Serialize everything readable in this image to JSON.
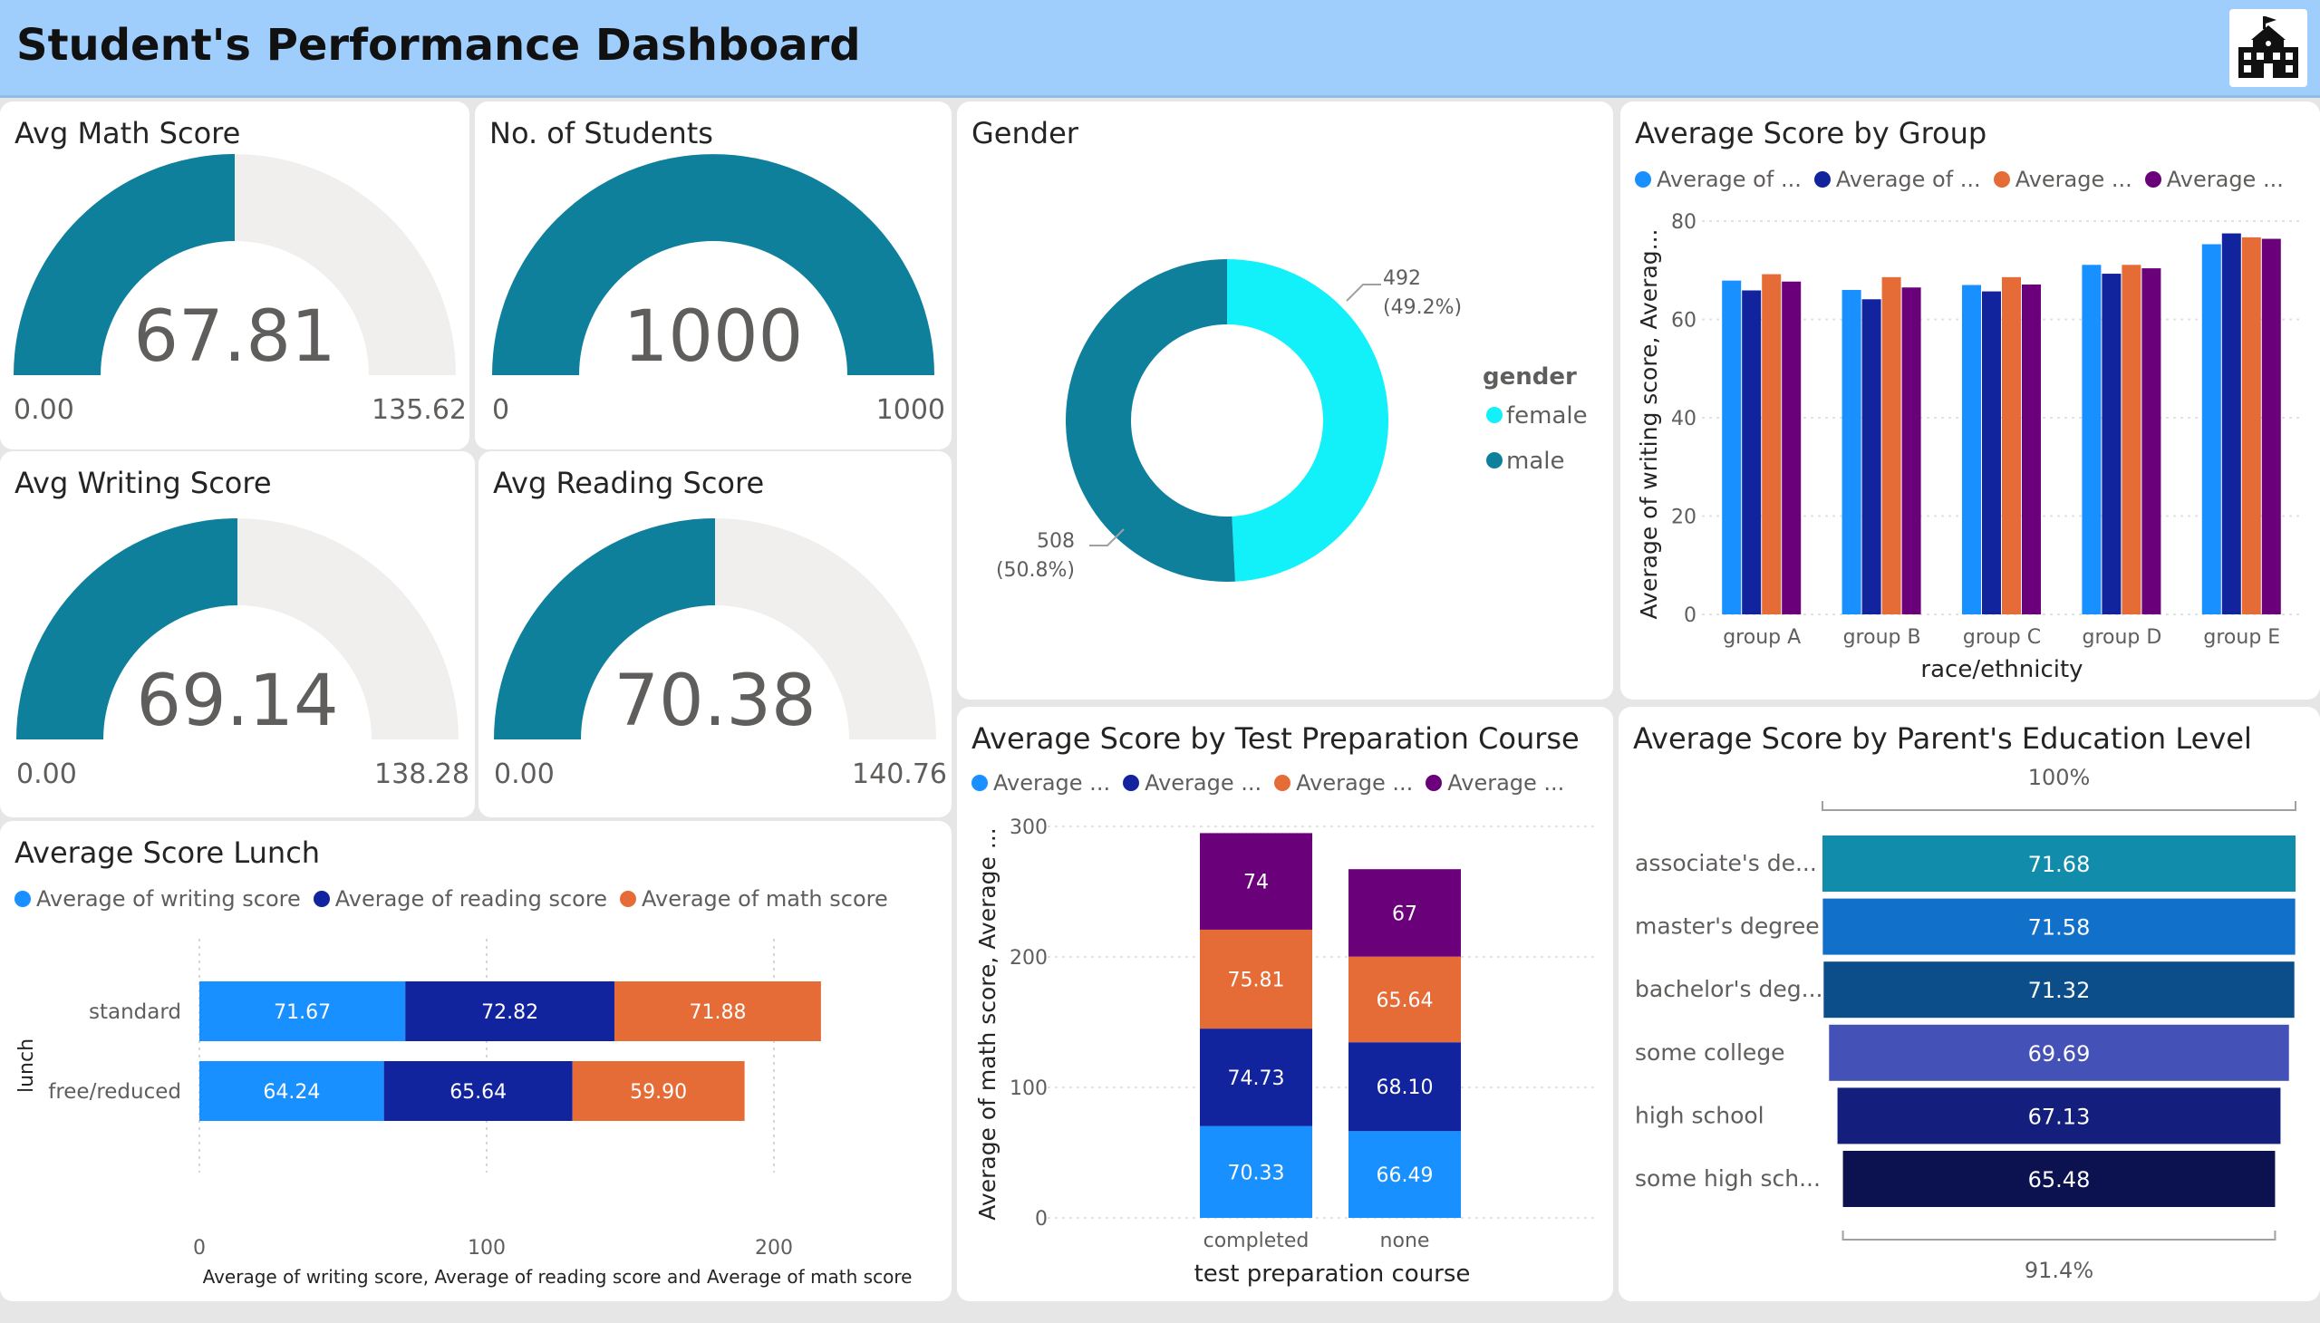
{
  "header": {
    "title": "Student's Performance Dashboard",
    "logo_icon": "school-building-icon"
  },
  "colors": {
    "teal": "#0e809c",
    "gauge_bg": "#f0efee",
    "c1": "#1890ff",
    "c2": "#12239e",
    "c3": "#e66c37",
    "c4": "#6b007b",
    "cyan": "#12f1fa"
  },
  "gauges": [
    {
      "title": "Avg Math Score",
      "value": 67.81,
      "value_label": "67.81",
      "min_label": "0.00",
      "max_label": "135.62",
      "fill_fraction": 0.5
    },
    {
      "title": "No. of Students",
      "value": 1000,
      "value_label": "1000",
      "min_label": "0",
      "max_label": "1000",
      "fill_fraction": 1.0
    },
    {
      "title": "Avg Writing Score",
      "value": 69.14,
      "value_label": "69.14",
      "min_label": "0.00",
      "max_label": "138.28",
      "fill_fraction": 0.5
    },
    {
      "title": "Avg Reading Score",
      "value": 70.38,
      "value_label": "70.38",
      "min_label": "0.00",
      "max_label": "140.76",
      "fill_fraction": 0.5
    }
  ],
  "gender": {
    "title": "Gender",
    "legend_title": "gender",
    "slices": [
      {
        "label": "female",
        "value": 492,
        "value_label": "492",
        "pct_label": "(49.2%)"
      },
      {
        "label": "male",
        "value": 508,
        "value_label": "508",
        "pct_label": "(50.8%)"
      }
    ]
  },
  "group": {
    "title": "Average Score by Group",
    "legend": [
      "Average of ...",
      "Average of ...",
      "Average ...",
      "Average ..."
    ],
    "ylabel": "Average of writing score, Averag...",
    "xlabel": "race/ethnicity",
    "yticks": [
      "0",
      "20",
      "40",
      "60",
      "80"
    ]
  },
  "lunch": {
    "title": "Average Score Lunch",
    "legend": [
      "Average of writing score",
      "Average of reading score",
      "Average of math score"
    ],
    "ylabel": "lunch",
    "xlabel": "Average of writing score, Average of reading score and Average of math score",
    "xticks": [
      "0",
      "100",
      "200"
    ]
  },
  "prep": {
    "title": "Average Score by Test Preparation Course",
    "legend": [
      "Average ...",
      "Average ...",
      "Average ...",
      "Average ..."
    ],
    "ylabel": "Average of math score, Average ...",
    "xlabel": "test preparation course",
    "yticks": [
      "0",
      "100",
      "200",
      "300"
    ]
  },
  "parent": {
    "title": "Average Score by Parent's Education Level",
    "top_label": "100%",
    "bottom_label": "91.4%"
  },
  "chart_data": [
    {
      "type": "bar",
      "title": "Average Score by Group",
      "xlabel": "race/ethnicity",
      "ylabel": "Average of writing score, Averag...",
      "categories": [
        "group A",
        "group B",
        "group C",
        "group D",
        "group E"
      ],
      "series": [
        {
          "name": "Average of ...",
          "values": [
            67.9,
            66.0,
            67.0,
            71.1,
            75.3
          ]
        },
        {
          "name": "Average of ...",
          "values": [
            65.9,
            64.1,
            65.7,
            69.3,
            77.5
          ]
        },
        {
          "name": "Average ...",
          "values": [
            69.2,
            68.6,
            68.6,
            71.1,
            76.7
          ]
        },
        {
          "name": "Average ...",
          "values": [
            67.7,
            66.5,
            67.1,
            70.4,
            76.4
          ]
        }
      ],
      "ylim": [
        0,
        80
      ],
      "legend": "top-left",
      "grid": true
    },
    {
      "type": "bar",
      "orientation": "horizontal-stacked",
      "title": "Average Score Lunch",
      "xlabel": "Average of writing score, Average of reading score and Average of math score",
      "ylabel": "lunch",
      "categories": [
        "standard",
        "free/reduced"
      ],
      "series": [
        {
          "name": "Average of writing score",
          "values": [
            71.67,
            64.24
          ],
          "labels": [
            "71.67",
            "64.24"
          ]
        },
        {
          "name": "Average of reading score",
          "values": [
            72.82,
            65.64
          ],
          "labels": [
            "72.82",
            "65.64"
          ]
        },
        {
          "name": "Average of math score",
          "values": [
            71.88,
            59.9
          ],
          "labels": [
            "71.88",
            "59.90"
          ]
        }
      ],
      "xlim": [
        0,
        220
      ],
      "legend": "top-left",
      "grid": true
    },
    {
      "type": "bar",
      "orientation": "vertical-stacked",
      "title": "Average Score by Test Preparation Course",
      "xlabel": "test preparation course",
      "ylabel": "Average of math score, Average ...",
      "categories": [
        "completed",
        "none"
      ],
      "series": [
        {
          "name": "Average ...",
          "values": [
            70.33,
            66.49
          ],
          "labels": [
            "70.33",
            "66.49"
          ]
        },
        {
          "name": "Average ...",
          "values": [
            74.73,
            68.1
          ],
          "labels": [
            "74.73",
            "68.10"
          ]
        },
        {
          "name": "Average ...",
          "values": [
            75.81,
            65.64
          ],
          "labels": [
            "75.81",
            "65.64"
          ]
        },
        {
          "name": "Average ...",
          "values": [
            74,
            67
          ],
          "labels": [
            "74",
            "67"
          ]
        }
      ],
      "ylim": [
        0,
        300
      ],
      "legend": "top-left",
      "grid": true
    },
    {
      "type": "funnel",
      "title": "Average Score by Parent's Education Level",
      "categories": [
        "associate's de...",
        "master's degree",
        "bachelor's deg...",
        "some college",
        "high school",
        "some high sch..."
      ],
      "values": [
        71.68,
        71.58,
        71.32,
        69.69,
        67.13,
        65.48
      ],
      "labels": [
        "71.68",
        "71.58",
        "71.32",
        "69.69",
        "67.13",
        "65.48"
      ],
      "colors": [
        "#118dab",
        "#1070ca",
        "#0b4e8a",
        "#4451b6",
        "#141e7c",
        "#0c124f"
      ]
    },
    {
      "type": "pie",
      "title": "Gender",
      "categories": [
        "female",
        "male"
      ],
      "values": [
        492,
        508
      ],
      "legend": "right"
    }
  ]
}
